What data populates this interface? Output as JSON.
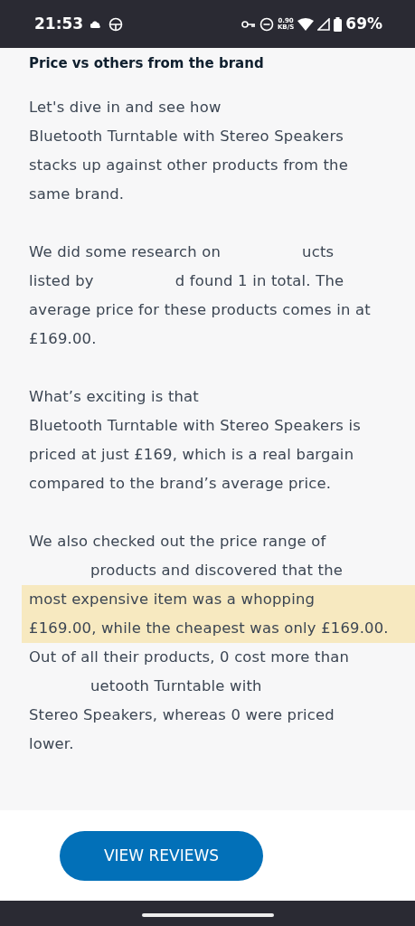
{
  "status_bar": {
    "time": "21:53",
    "speed_value": "0.90",
    "speed_unit": "KB/S",
    "battery": "69%"
  },
  "heading": "Price vs others from the brand",
  "paragraphs": [
    {
      "lines": [
        {
          "segments": [
            "Let's dive in and see how"
          ],
          "highlighted": false
        },
        {
          "segments": [
            "Bluetooth Turntable with Stereo Speakers"
          ],
          "highlighted": false
        },
        {
          "segments": [
            "stacks up against other products from the"
          ],
          "highlighted": false
        },
        {
          "segments": [
            "same brand."
          ],
          "highlighted": false
        }
      ]
    },
    {
      "lines": [
        {
          "segments": [
            "We did some research on",
            "ucts"
          ],
          "highlighted": false
        },
        {
          "segments": [
            "listed by",
            "d found 1 in total. The"
          ],
          "highlighted": false
        },
        {
          "segments": [
            "average price for these products comes in at"
          ],
          "highlighted": false
        },
        {
          "segments": [
            "£169.00."
          ],
          "highlighted": false
        }
      ]
    },
    {
      "lines": [
        {
          "segments": [
            "What’s exciting is that"
          ],
          "highlighted": false
        },
        {
          "segments": [
            "Bluetooth Turntable with Stereo Speakers is"
          ],
          "highlighted": false
        },
        {
          "segments": [
            "priced at just £169, which is a real bargain"
          ],
          "highlighted": false
        },
        {
          "segments": [
            "compared to the brand’s average price."
          ],
          "highlighted": false
        }
      ]
    },
    {
      "lines": [
        {
          "segments": [
            "We also checked out the price range of"
          ],
          "highlighted": false
        },
        {
          "segments": [
            "products and discovered that the"
          ],
          "indented": true,
          "highlighted": false
        },
        {
          "segments": [
            "most expensive item was a whopping"
          ],
          "highlighted": true
        },
        {
          "segments": [
            "£169.00, while the cheapest was only £169.00."
          ],
          "highlighted": true
        },
        {
          "segments": [
            "Out of all their products, 0 cost more than"
          ],
          "highlighted": false
        },
        {
          "segments": [
            "uetooth Turntable with"
          ],
          "indented": true,
          "highlighted": false
        },
        {
          "segments": [
            "Stereo Speakers, whereas 0 were priced"
          ],
          "highlighted": false
        },
        {
          "segments": [
            "lower."
          ],
          "highlighted": false
        }
      ]
    }
  ],
  "button": "VIEW REVIEWS"
}
